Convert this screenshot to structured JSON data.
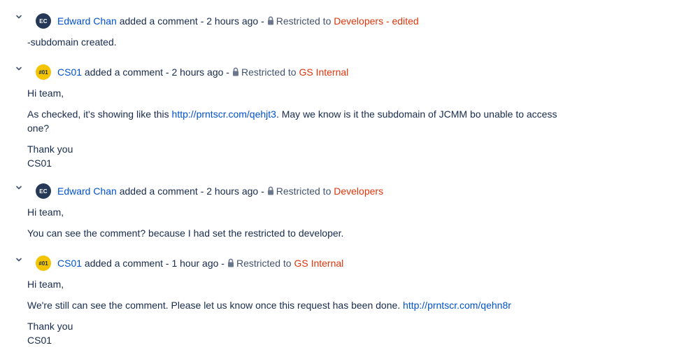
{
  "comments": [
    {
      "author": "Edward Chan",
      "avatar_initials": "EC",
      "action": "added a comment",
      "sep1": "-",
      "time": "2 hours ago",
      "sep2": "-",
      "restricted_prefix": "Restricted to",
      "restricted_group": "Developers",
      "edited": "- edited",
      "body": [
        "-subdomain created."
      ]
    },
    {
      "author": "CS01",
      "avatar_initials": "#01",
      "action": "added a comment",
      "sep1": "-",
      "time": "2 hours ago",
      "sep2": "-",
      "restricted_prefix": "Restricted to",
      "restricted_group": "GS Internal",
      "body_intro": "Hi team,",
      "body_p2_a": "As checked, it's showing like this ",
      "body_p2_link": "http://prntscr.com/qehjt3",
      "body_p2_b": ". May we know is it the subdomain of JCMM bo unable to access",
      "body_p2_c": "one?",
      "body_thanks": "Thank you",
      "body_sign": "CS01"
    },
    {
      "author": "Edward Chan",
      "avatar_initials": "EC",
      "action": "added a comment",
      "sep1": "-",
      "time": "2 hours ago",
      "sep2": "-",
      "restricted_prefix": "Restricted to",
      "restricted_group": "Developers",
      "body_intro": "Hi team,",
      "body_p2": "You can see the comment? because I had set the restricted to developer."
    },
    {
      "author": "CS01",
      "avatar_initials": "#01",
      "action": "added a comment",
      "sep1": "-",
      "time": "1 hour ago",
      "sep2": "-",
      "restricted_prefix": "Restricted to",
      "restricted_group": "GS Internal",
      "body_intro": "Hi team,",
      "body_p2_a": "We're still can see the comment. Please let us know once this request has been done. ",
      "body_p2_link": "http://prntscr.com/qehn8r",
      "body_thanks": "Thank you",
      "body_sign": "CS01"
    }
  ],
  "colors": {
    "link": "#0052cc",
    "restricted": "#de350b",
    "text": "#172b4d",
    "avatar_ec": "#253858",
    "avatar_cs": "#f5c400"
  },
  "icons": [
    "chevron-down-icon",
    "lock-icon"
  ]
}
